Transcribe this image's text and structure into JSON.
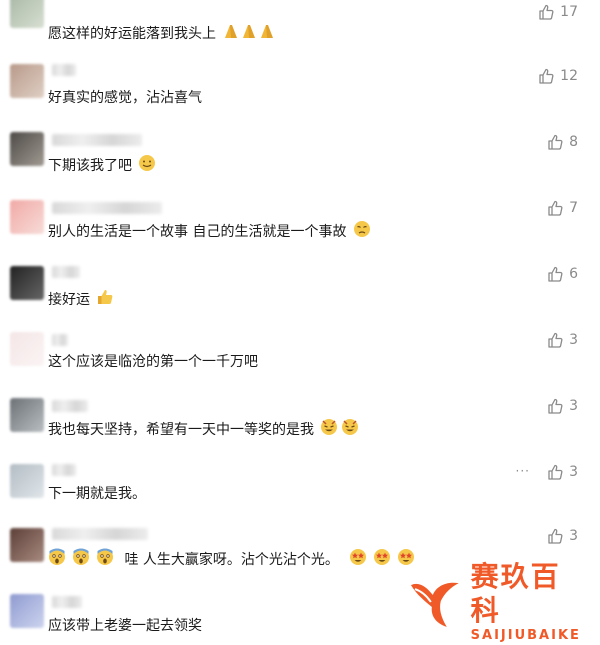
{
  "comments": [
    {
      "text": "愿这样的好运能落到我头上",
      "likes": "17",
      "emoji": [
        "pray-icon",
        "pray-icon",
        "pray-icon"
      ],
      "avatar_color": "#b9c6b8"
    },
    {
      "text": "好真实的感觉，沾沾喜气",
      "likes": "12",
      "emoji": [],
      "avatar_color": "#c9b3a6"
    },
    {
      "text": "下期该我了吧",
      "likes": "8",
      "emoji": [
        "smile-icon"
      ],
      "avatar_color": "#6f6a64"
    },
    {
      "text": "别人的生活是一个故事  自己的生活就是一个事故",
      "likes": "7",
      "emoji": [
        "sad-icon"
      ],
      "avatar_color": "#e8b7b4"
    },
    {
      "text": "接好运",
      "likes": "6",
      "emoji": [
        "thumbs-up-icon"
      ],
      "avatar_color": "#3c3c3c"
    },
    {
      "text": "这个应该是临沧的第一个一千万吧",
      "likes": "3",
      "emoji": [],
      "avatar_color": "#efe3e4"
    },
    {
      "text": "我也每天坚持，希望有一天中一等奖的是我",
      "likes": "3",
      "emoji": [
        "devil-grin-icon",
        "devil-grin-icon"
      ],
      "avatar_color": "#8a8f93"
    },
    {
      "text": "下一期就是我。",
      "likes": "3",
      "emoji": [],
      "avatar_color": "#c7cfd4",
      "menu": "···"
    },
    {
      "text": "哇  人生大赢家呀。沾个光沾个光。",
      "likes": "3",
      "emoji_before": [
        "scream-icon",
        "scream-icon",
        "scream-icon"
      ],
      "emoji": [
        "star-eyes-icon",
        "star-eyes-icon",
        "star-eyes-icon"
      ],
      "avatar_color": "#7b5d55"
    },
    {
      "text": "应该带上老婆一起去领奖",
      "likes": "",
      "emoji": [],
      "avatar_color": "#aab3d8"
    }
  ],
  "watermark": {
    "cn": "赛玖百科",
    "en": "SAIJIUBAIKE",
    "color": "#f05a28"
  }
}
